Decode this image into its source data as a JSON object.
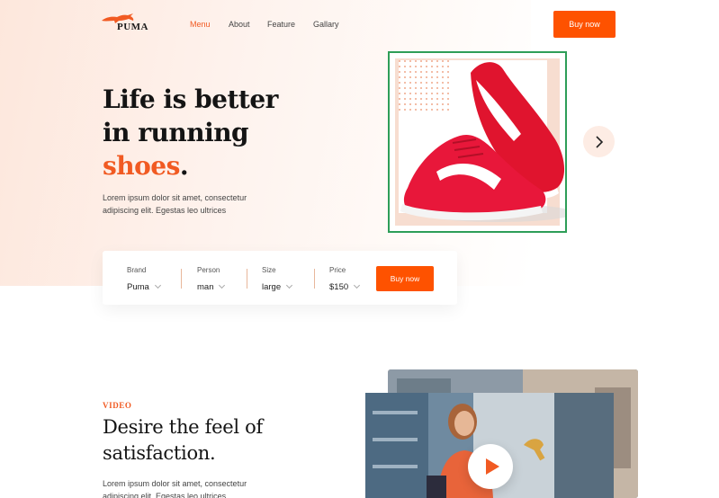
{
  "header": {
    "logo_text": "PUMA",
    "nav": [
      "Menu",
      "About",
      "Feature",
      "Gallary"
    ],
    "active_nav": "Menu",
    "cta_label": "Buy now"
  },
  "hero": {
    "title_line1": "Life is better",
    "title_line2": "in running",
    "title_accent": "shoes",
    "title_end": ".",
    "desc_line1": "Lorem ipsum dolor sit amet, consectetur",
    "desc_line2": "adipiscing elit. Egestas leo ultrices"
  },
  "filter": {
    "fields": [
      {
        "label": "Brand",
        "value": "Puma"
      },
      {
        "label": "Person",
        "value": "man"
      },
      {
        "label": "Size",
        "value": "large"
      },
      {
        "label": "Price",
        "value": "$150"
      }
    ],
    "cta_label": "Buy now"
  },
  "video_section": {
    "eyebrow": "VIDEO",
    "title_line1": "Desire the feel of",
    "title_line2": "satisfaction.",
    "desc_line1": "Lorem ipsum dolor sit amet, consectetur",
    "desc_line2": "adipiscing elit. Egestas leo ultrices"
  },
  "colors": {
    "accent": "#f15a22",
    "button": "#fe5200",
    "frame_highlight": "#2e9e58"
  },
  "icons": {
    "logo": "puma-cat-icon",
    "next": "chevron-right-icon",
    "play": "play-icon",
    "dropdown": "chevron-down-icon"
  }
}
